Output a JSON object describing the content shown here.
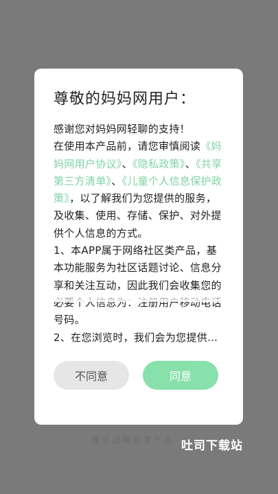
{
  "dialog": {
    "title": "尊敬的妈妈网用户：",
    "intro_line1": "感谢您对妈妈网轻聊的支持！",
    "intro_line2": "在使用本产品前，请您审慎阅读",
    "link_user_agreement": "《妈妈网用户协议》",
    "sep1": "、",
    "link_privacy_policy": "《隐私政策》",
    "sep2": "、",
    "link_third_party_list": "《共享第三方清单》",
    "sep3": "、",
    "link_child_privacy": "《儿童个人信息保护政策》",
    "paragraph1_tail": "，以了解我们为您提供的服务，及收集、使用、存储、保护、对外提供个人信息的方式。",
    "paragraph2": "1、本APP属于网络社区类产品，基本功能服务为社区话题讨论、信息分享和关注互动，因此我们会收集您的必要个人信息为：注册用户移动电话号码。",
    "paragraph3_partial": "2、在您浏览时，我们会为您提供…",
    "decline_label": "不同意",
    "agree_label": "同意"
  },
  "background_footer": "腾讯战略投资产品",
  "watermark": "吐司下载站",
  "colors": {
    "link": "#7fd3a4",
    "agree_button": "#88e0ab",
    "decline_button": "#e6e6e6",
    "overlay": "#7a7a7a"
  }
}
